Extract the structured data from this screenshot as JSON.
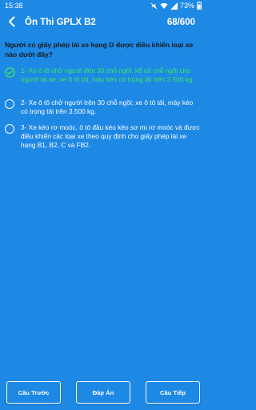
{
  "status_bar": {
    "time": "15:38",
    "battery": "73%"
  },
  "app_bar": {
    "title": "Ôn Thi GPLX B2",
    "counter": "68/600"
  },
  "question": {
    "text": "Người có giấy phép lái xe hạng D được điều khiển loại xe nào dưới đây?"
  },
  "options": [
    {
      "text": "1- Xe ô tô chở người đến 30 chỗ ngồi, kể cả chỗ ngồi cho người lái xe; xe ô tô tải, máy kéo có trọng tải trên 3.500 kg.",
      "state": "correct"
    },
    {
      "text": "2- Xe ô tô chở người trên 30 chỗ ngồi; xe ô tô tải, máy kéo có trọng tải trên 3.500 kg.",
      "state": "unselected"
    },
    {
      "text": "3- Xe kéo rơ moóc, ô tô đầu kéo kéo sơ mi rơ moóc và được điều khiển các loại xe theo quy định cho giấy phép lái xe hạng B1, B2, C và FB2.",
      "state": "unselected"
    }
  ],
  "buttons": {
    "prev": "Câu Trước",
    "answer": "Đáp Án",
    "next": "Câu Tiếp"
  },
  "colors": {
    "background": "#1e88e5",
    "correct": "#3ee85a",
    "text_light": "#ffffff",
    "question_text": "#1a1a1a"
  },
  "icons": {
    "back": "arrow-left-icon",
    "correct": "check-circle-icon",
    "radio": "radio-unchecked-icon"
  }
}
